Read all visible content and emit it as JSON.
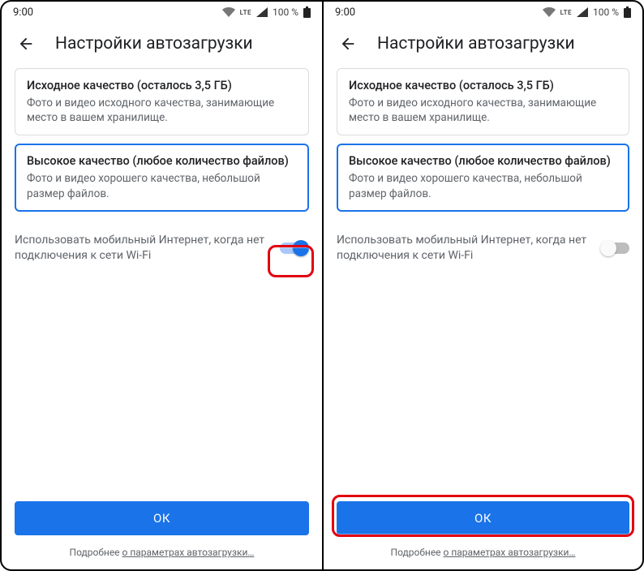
{
  "status": {
    "time": "9:00",
    "lte": "LTE",
    "battery": "100 %"
  },
  "header": {
    "title": "Настройки автозагрузки"
  },
  "options": {
    "original": {
      "title": "Исходное качество (осталось 3,5 ГБ)",
      "desc": "Фото и видео исходного качества, занимающие место в вашем хранилище."
    },
    "high": {
      "title": "Высокое качество (любое количество файлов)",
      "desc": "Фото и видео хорошего качества, небольшой размер файлов."
    }
  },
  "toggle": {
    "label": "Использовать мобильный Интернет, когда нет подключения к сети Wi-Fi"
  },
  "footer": {
    "ok": "ОК",
    "more_prefix": "Подробнее ",
    "more_link": "о параметрах автозагрузки…"
  }
}
